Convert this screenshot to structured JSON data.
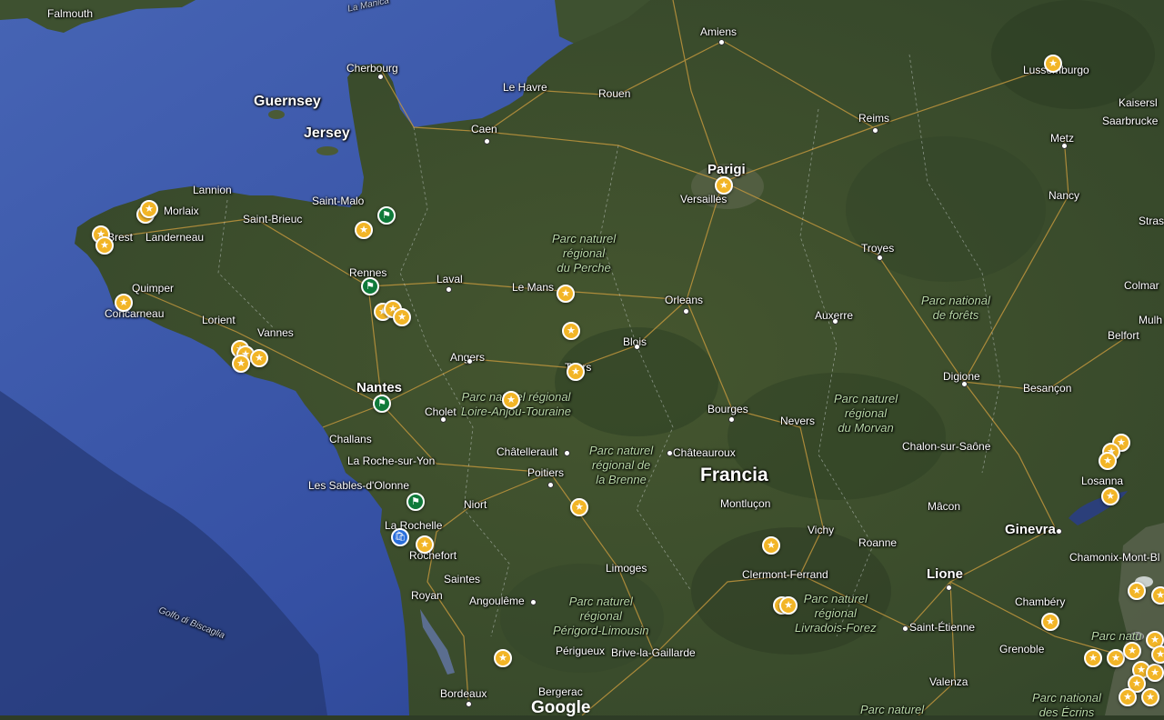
{
  "colors": {
    "sea": "#3a57a5",
    "land": "#3b4d2c",
    "roads": "#c89a3e",
    "star_marker": "#f2b527",
    "flag_marker": "#0f7a3a",
    "bag_marker": "#2a6fdb"
  },
  "labels": {
    "falmouth": "Falmouth",
    "la_manica": "La Manica",
    "guernsey": "Guernsey",
    "jersey": "Jersey",
    "cherbourg": "Cherbourg",
    "le_havre": "Le Havre",
    "rouen": "Rouen",
    "amiens": "Amiens",
    "caen": "Caen",
    "reims": "Reims",
    "lussemburgo": "Lussemburgo",
    "kaiserslautern": "Kaisersl",
    "saarbrucken": "Saarbrucke",
    "metz": "Metz",
    "parigi": "Parigi",
    "versailles": "Versailles",
    "nancy": "Nancy",
    "strasbourg": "Stras",
    "lannion": "Lannion",
    "morlaix": "Morlaix",
    "saint_malo": "Saint-Malo",
    "saint_brieuc": "Saint-Brieuc",
    "brest": "Brest",
    "landerneau": "Landerneau",
    "troyes": "Troyes",
    "rennes": "Rennes",
    "laval": "Laval",
    "le_mans": "Le Mans",
    "quimper": "Quimper",
    "concarneau": "Concarneau",
    "lorient": "Lorient",
    "vannes": "Vannes",
    "orleans": "Orleans",
    "auxerre": "Auxerre",
    "colmar": "Colmar",
    "mulhouse": "Mulh",
    "belfort": "Belfort",
    "blois": "Blois",
    "angers": "Angers",
    "tours": "Tours",
    "digione": "Digione",
    "nantes": "Nantes",
    "besancon": "Besançon",
    "cholet": "Cholet",
    "bourges": "Bourges",
    "nevers": "Nevers",
    "challans": "Challans",
    "la_roche_sur_yon": "La Roche-sur-Yon",
    "chatellerault": "Châtellerault",
    "chateauroux": "Châteauroux",
    "chalon_sur_saone": "Chalon-sur-Saône",
    "poitiers": "Poitiers",
    "losanna": "Losanna",
    "les_sables": "Les Sables-d'Olonne",
    "francia": "Francia",
    "niort": "Niort",
    "montlucon": "Montluçon",
    "macon": "Mâcon",
    "la_rochelle": "La Rochelle",
    "vichy": "Vichy",
    "roanne": "Roanne",
    "ginevra": "Ginevra",
    "rochefort": "Rochefort",
    "chamonix": "Chamonix-Mont-Bl",
    "limoges": "Limoges",
    "clermont_ferrand": "Clermont-Ferrand",
    "lione": "Lione",
    "saintes": "Saintes",
    "royan": "Royan",
    "angouleme": "Angoulême",
    "chambery": "Chambéry",
    "saint_etienne": "Saint-Étienne",
    "golfo_biscaglia": "Golfo di Biscaglia",
    "perigueux": "Périgueux",
    "brive": "Brive-la-Gaillarde",
    "grenoble": "Grenoble",
    "valenza": "Valenza",
    "bordeaux": "Bordeaux",
    "bergerac": "Bergerac",
    "google": "Google"
  },
  "parks": {
    "perche": "Parc naturel\nrégional\ndu Perche",
    "loire": "Parc naturel régional\nLoire-Anjou-Touraine",
    "brenne": "Parc naturel\nrégional de\nla Brenne",
    "morvan": "Parc naturel\nrégional\ndu Morvan",
    "forets": "Parc national\nde forêts",
    "perigord": "Parc naturel\nrégional\nPérigord-Limousin",
    "livradois": "Parc naturel\nrégional\nLivradois-Forez",
    "ecrins": "Parc national\ndes Écrins",
    "bottom": "Parc naturel",
    "alpine": "Parc natu"
  },
  "markers": {
    "star_icon": "★",
    "flag_icon": "⚑",
    "bag_icon": "🛍"
  }
}
